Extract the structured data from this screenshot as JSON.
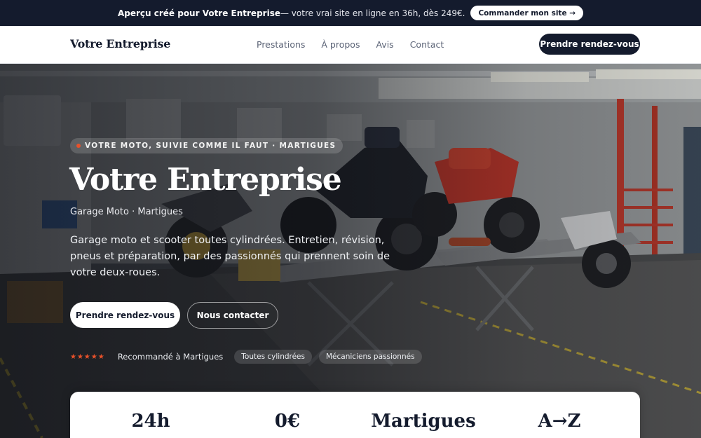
{
  "promo": {
    "bold": "Aperçu créé pour Votre Entreprise",
    "rest": " — votre vrai site en ligne en 36h, dès 249€.",
    "button": "Commander mon site →"
  },
  "nav": {
    "brand": "Votre Entreprise",
    "links": [
      "Prestations",
      "À propos",
      "Avis",
      "Contact"
    ],
    "cta": "Prendre rendez-vous"
  },
  "hero": {
    "eyebrow": "VOTRE MOTO, SUIVIE COMME IL FAUT · MARTIGUES",
    "title": "Votre Entreprise",
    "subtitle": "Garage Moto · Martigues",
    "description": "Garage moto et scooter toutes cylindrées. Entretien, révision, pneus et préparation, par des passionnés qui prennent soin de votre deux-roues.",
    "primary_button": "Prendre rendez-vous",
    "secondary_button": "Nous contacter",
    "stars": "★★★★★",
    "recommendation": "Recommandé à Martigues",
    "pills": [
      "Toutes cylindrées",
      "Mécaniciens passionnés"
    ]
  },
  "stats": [
    "24h",
    "0€",
    "Martigues",
    "A→Z"
  ],
  "colors": {
    "accent": "#e8512a",
    "dark": "#141b2d"
  }
}
